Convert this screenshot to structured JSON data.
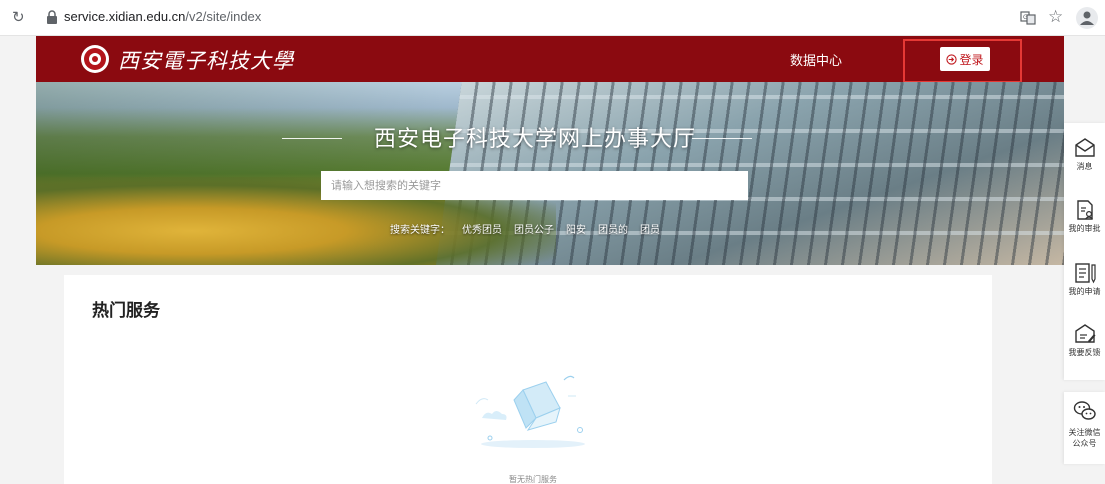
{
  "browser": {
    "url_domain": "service.xidian.edu.cn",
    "url_path": "/v2/site/index"
  },
  "header": {
    "logo_text": "西安電子科技大學",
    "nav_data_center": "数据中心",
    "login_label": "登录",
    "brand_color": "#8b0a10"
  },
  "hero": {
    "title": "西安电子科技大学网上办事大厅",
    "search_placeholder": "请输入想搜索的关键字",
    "hot_keywords": [
      "搜索关键字：",
      "优秀团员",
      "团员公子",
      "阳安",
      "团员的",
      "团员"
    ]
  },
  "main": {
    "section_title": "热门服务",
    "empty_text": "暂无热门服务"
  },
  "right_rail": {
    "items": [
      {
        "label": "消息",
        "icon": "message-icon"
      },
      {
        "label": "我的审批",
        "icon": "approval-icon"
      },
      {
        "label": "我的申请",
        "icon": "application-icon"
      },
      {
        "label": "我要反馈",
        "icon": "feedback-icon"
      }
    ],
    "wechat_label_line1": "关注微信",
    "wechat_label_line2": "公众号"
  }
}
